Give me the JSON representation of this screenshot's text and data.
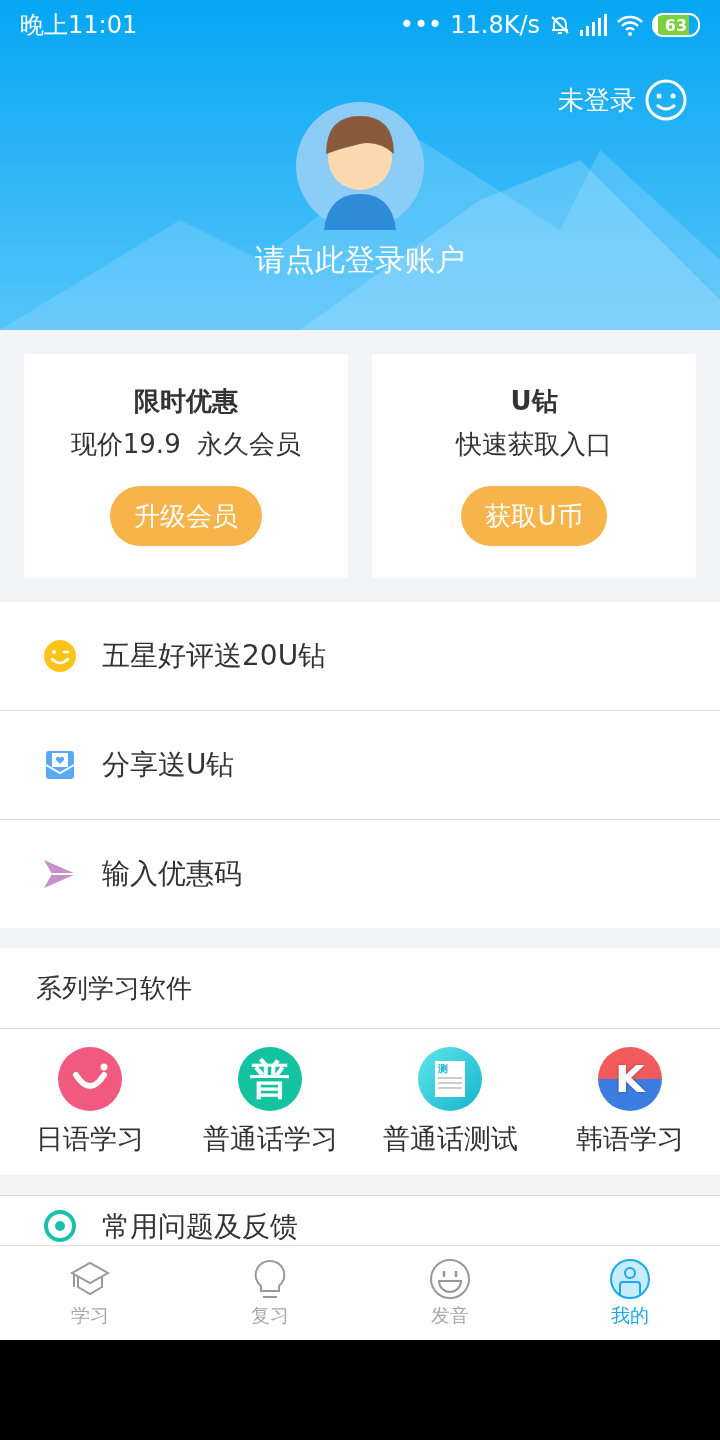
{
  "status_bar": {
    "time": "晚上11:01",
    "dots": "•••",
    "speed": "11.8K/s",
    "battery": "63"
  },
  "header": {
    "login_status": "未登录",
    "prompt": "请点此登录账户"
  },
  "promo_cards": [
    {
      "title": "限时优惠",
      "subtitle": "现价19.9  永久会员",
      "button": "升级会员"
    },
    {
      "title": "U钻",
      "subtitle": "快速获取入口",
      "button": "获取U币"
    }
  ],
  "menu": [
    {
      "kind": "smile",
      "label": "五星好评送20U钻"
    },
    {
      "kind": "share",
      "label": "分享送U钻"
    },
    {
      "kind": "coupon",
      "label": "输入优惠码"
    }
  ],
  "apps_section": {
    "title": "系列学习软件",
    "apps": [
      {
        "kind": "japanese",
        "label": "日语学习"
      },
      {
        "kind": "putonghua",
        "glyph": "普",
        "label": "普通话学习"
      },
      {
        "kind": "test",
        "glyph": "测",
        "label": "普通话测试"
      },
      {
        "kind": "korean",
        "glyph": "K",
        "label": "韩语学习"
      }
    ]
  },
  "more_menu": [
    {
      "kind": "feedback",
      "label": "常用问题及反馈"
    }
  ],
  "tab_bar": [
    {
      "kind": "study",
      "label": "学习",
      "selected": false
    },
    {
      "kind": "review",
      "label": "复习",
      "selected": false
    },
    {
      "kind": "pronounce",
      "label": "发音",
      "selected": false
    },
    {
      "kind": "me",
      "label": "我的",
      "selected": true
    }
  ]
}
